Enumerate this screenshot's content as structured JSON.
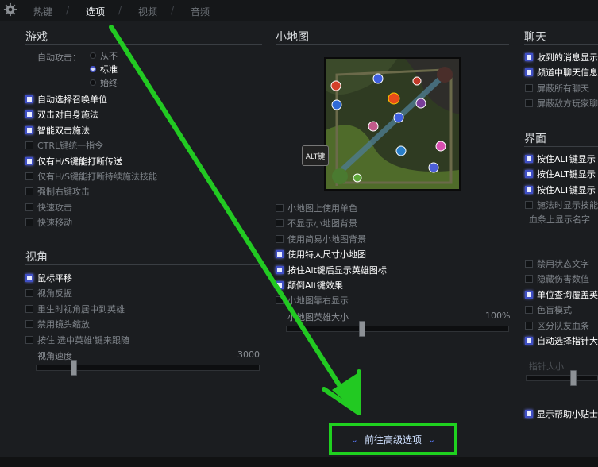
{
  "tabs": [
    "热键",
    "选项",
    "视频",
    "音频"
  ],
  "active_tab": 1,
  "sections": {
    "game": {
      "title": "游戏",
      "auto_attack_label": "自动攻击：",
      "auto_attack_options": [
        "从不",
        "标准",
        "始终"
      ],
      "auto_attack_selected": 1,
      "options": [
        {
          "label": "自动选择召唤单位",
          "checked": true
        },
        {
          "label": "双击对自身施法",
          "checked": true
        },
        {
          "label": "智能双击施法",
          "checked": true
        },
        {
          "label": "CTRL键统一指令",
          "checked": false
        },
        {
          "label": "仅有H/S键能打断传送",
          "checked": true
        },
        {
          "label": "仅有H/S键能打断持续施法技能",
          "checked": false
        },
        {
          "label": "强制右键攻击",
          "checked": false
        },
        {
          "label": "快速攻击",
          "checked": false
        },
        {
          "label": "快速移动",
          "checked": false
        }
      ]
    },
    "view": {
      "title": "视角",
      "options": [
        {
          "label": "鼠标平移",
          "checked": true
        },
        {
          "label": "视角反握",
          "checked": false
        },
        {
          "label": "重生时视角居中到英雄",
          "checked": false
        },
        {
          "label": "禁用镜头缩放",
          "checked": false
        },
        {
          "label": "按住'选中英雄'键来跟随",
          "checked": false
        }
      ],
      "speed_label": "视角速度",
      "speed_value": "3000",
      "speed_fraction": 0.17
    },
    "minimap": {
      "title": "小地图",
      "alt_key": "ALT键",
      "options": [
        {
          "label": "小地图上使用单色",
          "checked": false
        },
        {
          "label": "不显示小地图背景",
          "checked": false
        },
        {
          "label": "使用简易小地图背景",
          "checked": false
        },
        {
          "label": "使用特大尺寸小地图",
          "checked": true
        },
        {
          "label": "按住Alt键后显示英雄图标",
          "checked": true
        },
        {
          "label": "颠倒Alt键效果",
          "checked": true
        },
        {
          "label": "小地图靠右显示",
          "checked": false
        }
      ],
      "hero_size_label": "小地图英雄大小",
      "hero_size_value": "100%",
      "hero_size_fraction": 0.34
    },
    "chat": {
      "title": "聊天",
      "options": [
        {
          "label": "收到的消息显示",
          "checked": true
        },
        {
          "label": "频道中聊天信息",
          "checked": true
        },
        {
          "label": "屏蔽所有聊天",
          "checked": false
        },
        {
          "label": "屏蔽敌方玩家聊",
          "checked": false
        }
      ]
    },
    "interface": {
      "title": "界面",
      "options": [
        {
          "label": "按住ALT键显示",
          "checked": true
        },
        {
          "label": "按住ALT键显示",
          "checked": true
        },
        {
          "label": "按住ALT键显示",
          "checked": true
        },
        {
          "label": "施法时显示技能",
          "checked": false
        }
      ],
      "hp_bar_label": "血条上显示名字",
      "options2": [
        {
          "label": "禁用状态文字",
          "checked": false
        },
        {
          "label": "隐藏伤害数值",
          "checked": false
        },
        {
          "label": "单位查询覆盖英",
          "checked": true
        },
        {
          "label": "色盲模式",
          "checked": false
        },
        {
          "label": "区分队友血条",
          "checked": false
        },
        {
          "label": "自动选择指针大",
          "checked": true
        }
      ],
      "pointer_size_label": "指针大小",
      "options3": [
        {
          "label": "显示帮助小贴士",
          "checked": true
        }
      ]
    }
  },
  "advanced_button": "前往高级选项",
  "colors": {
    "highlight": "#1fd11f",
    "accent": "#3f4fc4"
  }
}
